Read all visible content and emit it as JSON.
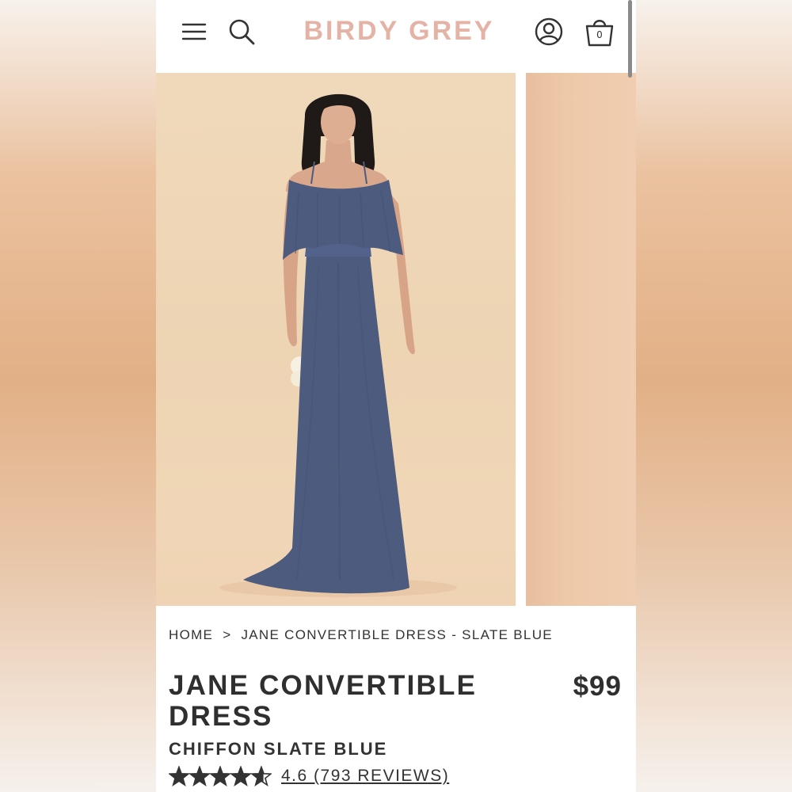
{
  "brand": {
    "name": "BIRDY GREY",
    "color": "#e4b3a6"
  },
  "header": {
    "menu_icon": "hamburger-menu-icon",
    "search_icon": "search-icon",
    "account_icon": "user-account-icon",
    "cart_icon": "shopping-bag-icon",
    "cart_count": "0"
  },
  "gallery": {
    "dress_color": "#4d5b7f",
    "background": "#efd4b2"
  },
  "breadcrumb": {
    "home": "HOME",
    "separator": ">",
    "current": "JANE CONVERTIBLE DRESS - SLATE BLUE"
  },
  "product": {
    "title": "JANE CONVERTIBLE DRESS",
    "price": "$99",
    "subtitle": "CHIFFON SLATE BLUE",
    "rating_value": 4.6,
    "rating_max": 5,
    "reviews_label": "4.6 (793 REVIEWS)"
  }
}
